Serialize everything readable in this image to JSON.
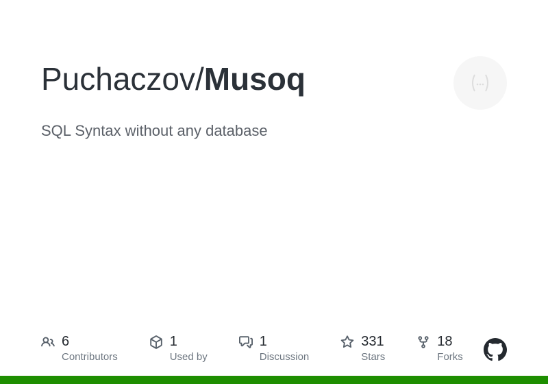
{
  "repo": {
    "owner": "Puchaczov",
    "name": "Musoq",
    "separator": "/"
  },
  "description": "SQL Syntax without any database",
  "stats": [
    {
      "icon": "contributors-icon",
      "count": "6",
      "label": "Contributors"
    },
    {
      "icon": "usedby-icon",
      "count": "1",
      "label": "Used by"
    },
    {
      "icon": "discussion-icon",
      "count": "1",
      "label": "Discussion"
    },
    {
      "icon": "star-icon",
      "count": "331",
      "label": "Stars"
    },
    {
      "icon": "fork-icon",
      "count": "18",
      "label": "Forks"
    }
  ],
  "colors": {
    "accent_bar": "#1e8e00"
  }
}
